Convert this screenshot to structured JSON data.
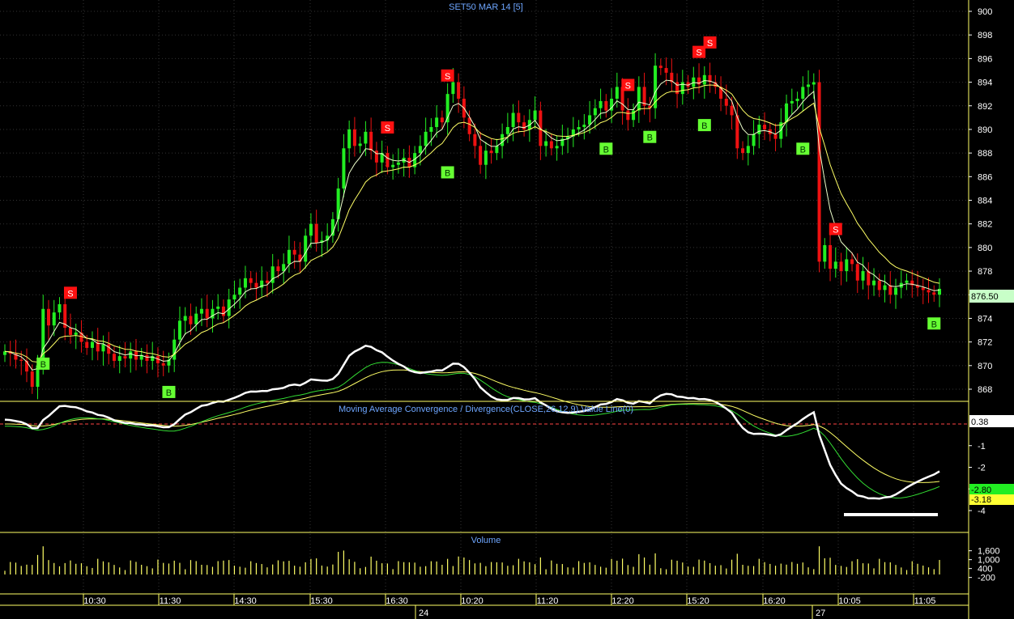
{
  "colors": {
    "background": "#000000",
    "grid": "#333333",
    "frame": "#ffff66",
    "up": "#22ee22",
    "down": "#ee1111",
    "ma": "#ffff66",
    "macd": "#ffffff",
    "signal_green": "#33dd33",
    "signal_yellow": "#ffff66",
    "buy": "#66ff33",
    "sell": "#ff1111",
    "title": "#6ea6ff"
  },
  "chart_data": [
    {
      "type": "candlestick",
      "title": "SET50 MAR 14   [5]",
      "ylim": [
        866,
        901
      ],
      "y_ticks": [
        "900",
        "898",
        "896",
        "894",
        "892",
        "890",
        "888",
        "886",
        "884",
        "882",
        "880",
        "878",
        "876",
        "874",
        "872",
        "870",
        "868"
      ],
      "y_tick_values": [
        900,
        898,
        896,
        894,
        892,
        890,
        888,
        886,
        884,
        882,
        880,
        878,
        876,
        874,
        872,
        870,
        868
      ],
      "last_price": "876.50",
      "last_price_value": 876.5,
      "close_series": [
        871.2,
        871.0,
        870.5,
        870.4,
        869.5,
        868.2,
        870.0,
        874.8,
        873.4,
        874.5,
        875.2,
        873.2,
        872.6,
        872.8,
        872.0,
        871.5,
        872.0,
        871.2,
        871.8,
        871.0,
        870.4,
        870.8,
        870.6,
        871.2,
        870.5,
        870.9,
        870.4,
        870.8,
        870.2,
        870.0,
        870.5,
        872.2,
        873.8,
        874.2,
        873.5,
        874.4,
        874.8,
        874.0,
        874.8,
        875.0,
        874.2,
        875.6,
        876.0,
        876.6,
        877.4,
        877.0,
        876.6,
        877.2,
        877.0,
        878.4,
        878.0,
        878.6,
        879.8,
        879.4,
        878.8,
        881.0,
        882.0,
        880.4,
        880.6,
        881.0,
        882.4,
        885.0,
        888.4,
        890.0,
        888.6,
        888.8,
        889.8,
        888.2,
        887.2,
        888.0,
        886.8,
        887.0,
        887.2,
        887.6,
        886.8,
        888.0,
        888.6,
        889.8,
        890.2,
        891.0,
        890.6,
        893.0,
        894.0,
        892.6,
        891.0,
        889.6,
        888.6,
        887.0,
        888.2,
        888.0,
        888.6,
        889.6,
        890.2,
        891.4,
        890.6,
        890.0,
        890.8,
        891.6,
        888.6,
        889.0,
        888.4,
        888.6,
        889.2,
        889.4,
        890.0,
        890.2,
        890.4,
        891.2,
        891.8,
        892.4,
        891.6,
        892.6,
        893.6,
        891.6,
        890.8,
        891.6,
        893.6,
        892.0,
        891.8,
        895.4,
        895.2,
        894.8,
        894.0,
        893.0,
        894.0,
        893.6,
        894.4,
        893.8,
        894.6,
        894.0,
        893.6,
        892.6,
        892.0,
        891.2,
        888.4,
        888.0,
        888.6,
        889.6,
        890.4,
        890.0,
        889.6,
        889.2,
        890.6,
        892.2,
        892.4,
        892.6,
        893.6,
        893.8,
        894.0,
        878.8,
        880.2,
        878.2,
        878.8,
        878.0,
        879.0,
        878.6,
        877.2,
        878.0,
        876.8,
        877.2,
        876.4,
        876.8,
        876.0,
        876.6,
        877.0,
        877.2,
        876.8,
        876.6,
        876.4,
        876.2,
        876.0,
        876.5
      ],
      "buy_signals": [
        {
          "label": "B",
          "index": 7,
          "price": 870.2
        },
        {
          "label": "B",
          "index": 30,
          "price": 867.8
        },
        {
          "label": "B",
          "index": 81,
          "price": 886.4
        },
        {
          "label": "B",
          "index": 110,
          "price": 888.4
        },
        {
          "label": "B",
          "index": 118,
          "price": 889.4
        },
        {
          "label": "B",
          "index": 128,
          "price": 890.4
        },
        {
          "label": "B",
          "index": 146,
          "price": 888.4
        },
        {
          "label": "B",
          "index": 170,
          "price": 873.6
        }
      ],
      "sell_signals": [
        {
          "label": "S",
          "index": 12,
          "price": 876.2
        },
        {
          "label": "S",
          "index": 70,
          "price": 890.2
        },
        {
          "label": "S",
          "index": 81,
          "price": 894.6
        },
        {
          "label": "S",
          "index": 114,
          "price": 893.8
        },
        {
          "label": "S",
          "index": 127,
          "price": 896.6
        },
        {
          "label": "S",
          "index": 129,
          "price": 897.4
        },
        {
          "label": "S",
          "index": 152,
          "price": 881.6
        }
      ]
    },
    {
      "type": "line",
      "title": "Moving Average Convergence / Divergence(CLOSE,26,12,9),Value Line(0)",
      "y_ticks": [
        "-1",
        "-2",
        "-3",
        "-4"
      ],
      "y_tick_values": [
        -1,
        -2,
        -3,
        -4
      ],
      "ylim": [
        -4.3,
        1.0
      ],
      "zero_line": 0,
      "values_shown": {
        "macd": "0.38",
        "signal_fast": "-2.80",
        "signal_slow": "-3.18"
      },
      "macd_value": 0.38,
      "signal_fast_value": -2.8,
      "signal_slow_value": -3.18
    },
    {
      "type": "bar",
      "title": "Volume",
      "y_ticks": [
        "1,600",
        "1,000",
        "400",
        "-200"
      ],
      "y_tick_values": [
        1600,
        1000,
        400,
        -200
      ],
      "ylim": [
        -500,
        2000
      ]
    }
  ],
  "time_axis": {
    "labels": [
      "10:30",
      "11:30",
      "14:30",
      "15:30",
      "16:30",
      "10:20",
      "11:20",
      "12:20",
      "15:20",
      "16:20",
      "10:05",
      "11:05"
    ],
    "dates": [
      "24",
      "27"
    ]
  }
}
